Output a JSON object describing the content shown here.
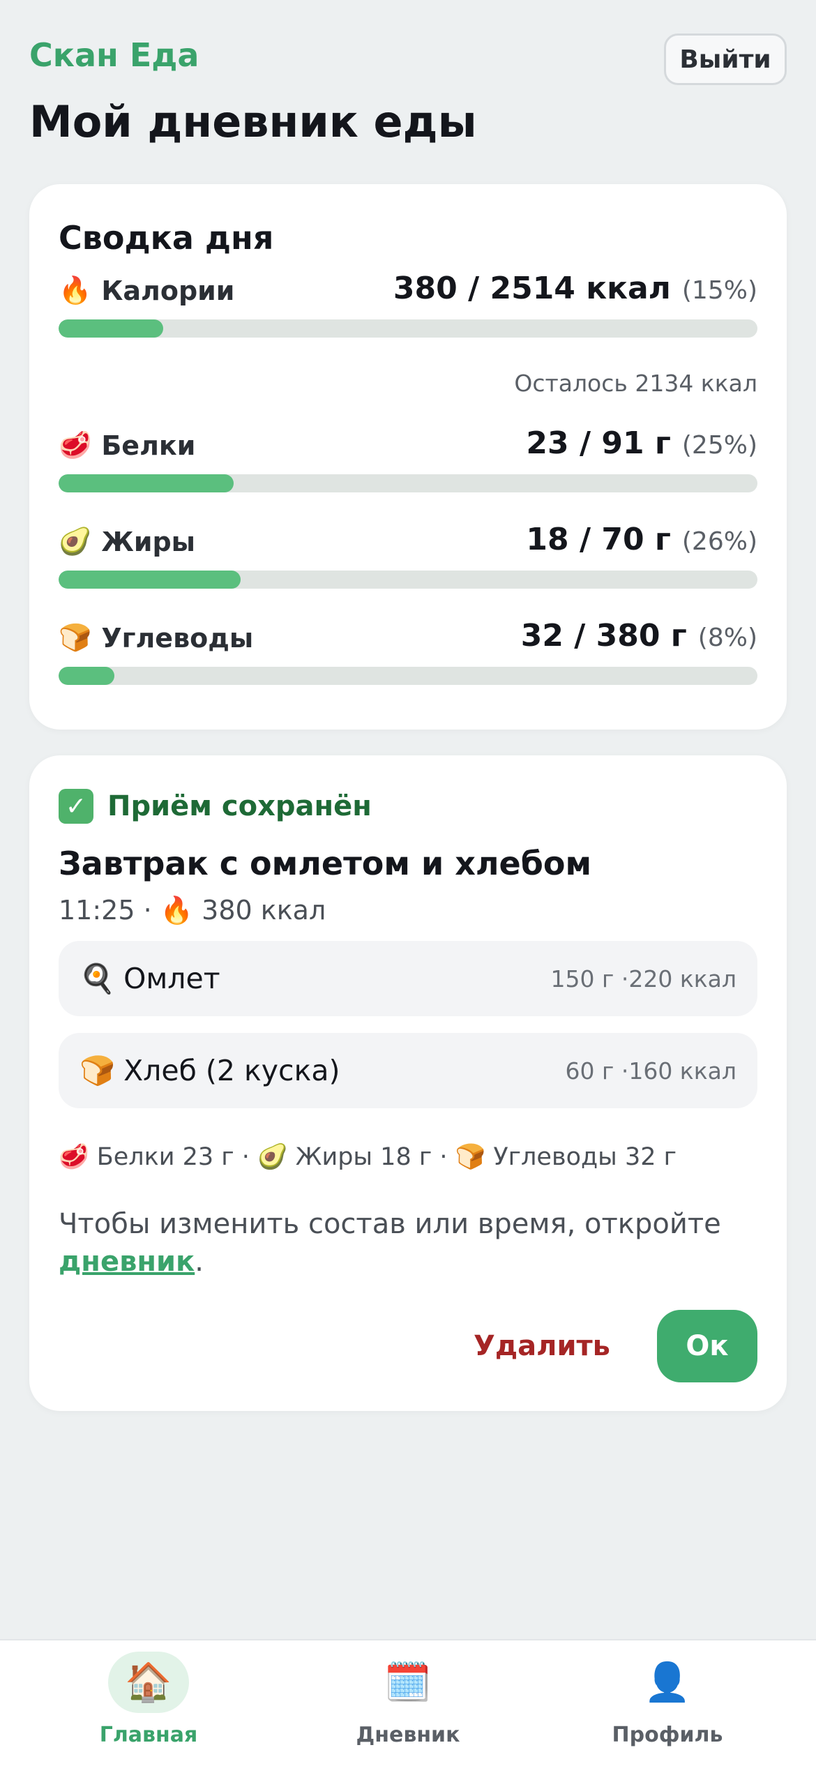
{
  "header": {
    "brand": "Скан Еда",
    "logout_label": "Выйти",
    "page_title": "Мой дневник еды"
  },
  "summary": {
    "title": "Сводка дня",
    "metrics": [
      {
        "icon": "fire-icon",
        "emoji": "🔥",
        "label": "Калории",
        "amount": "380 / 2514 ккал",
        "percent": "(15%)",
        "progress": 0.15
      },
      {
        "icon": "meat-icon",
        "emoji": "🥩",
        "label": "Белки",
        "amount": "23 / 91 г",
        "percent": "(25%)",
        "progress": 0.25
      },
      {
        "icon": "avocado-icon",
        "emoji": "🥑",
        "label": "Жиры",
        "amount": "18 / 70 г",
        "percent": "(26%)",
        "progress": 0.26
      },
      {
        "icon": "bread-icon",
        "emoji": "🍞",
        "label": "Углеводы",
        "amount": "32 / 380 г",
        "percent": "(8%)",
        "progress": 0.08
      }
    ],
    "remaining": "Осталось 2134 ккал"
  },
  "meal": {
    "saved_label": "Приём сохранён",
    "title": "Завтрак с омлетом и хлебом",
    "meta": "11:25 · 🔥 380 ккал",
    "items": [
      {
        "icon": "frying-pan-icon",
        "emoji": "🍳",
        "name": "Омлет",
        "detail": "150 г ·220 ккал"
      },
      {
        "icon": "bread-icon",
        "emoji": "🍞",
        "name": "Хлеб (2 куска)",
        "detail": "60 г ·160 ккал"
      }
    ],
    "macros": "🥩 Белки 23 г · 🥑 Жиры 18 г · 🍞 Углеводы 32 г",
    "hint_text": "Чтобы изменить состав или время, откройте",
    "hint_link": "дневник",
    "hint_end": ".",
    "delete_label": "Удалить",
    "ok_label": "Ок"
  },
  "nav": {
    "items": [
      {
        "icon": "home-icon",
        "emoji": "🏠",
        "label": "Главная",
        "active": true
      },
      {
        "icon": "calendar-icon",
        "emoji": "🗓️",
        "label": "Дневник",
        "active": false
      },
      {
        "icon": "profile-icon",
        "emoji": "👤",
        "label": "Профиль",
        "active": false
      }
    ]
  },
  "colors": {
    "accent": "#3aa36b",
    "progress_fill": "#5bbf7e",
    "progress_track": "#dfe4e1",
    "danger": "#a52525",
    "background": "#edf0f1"
  }
}
